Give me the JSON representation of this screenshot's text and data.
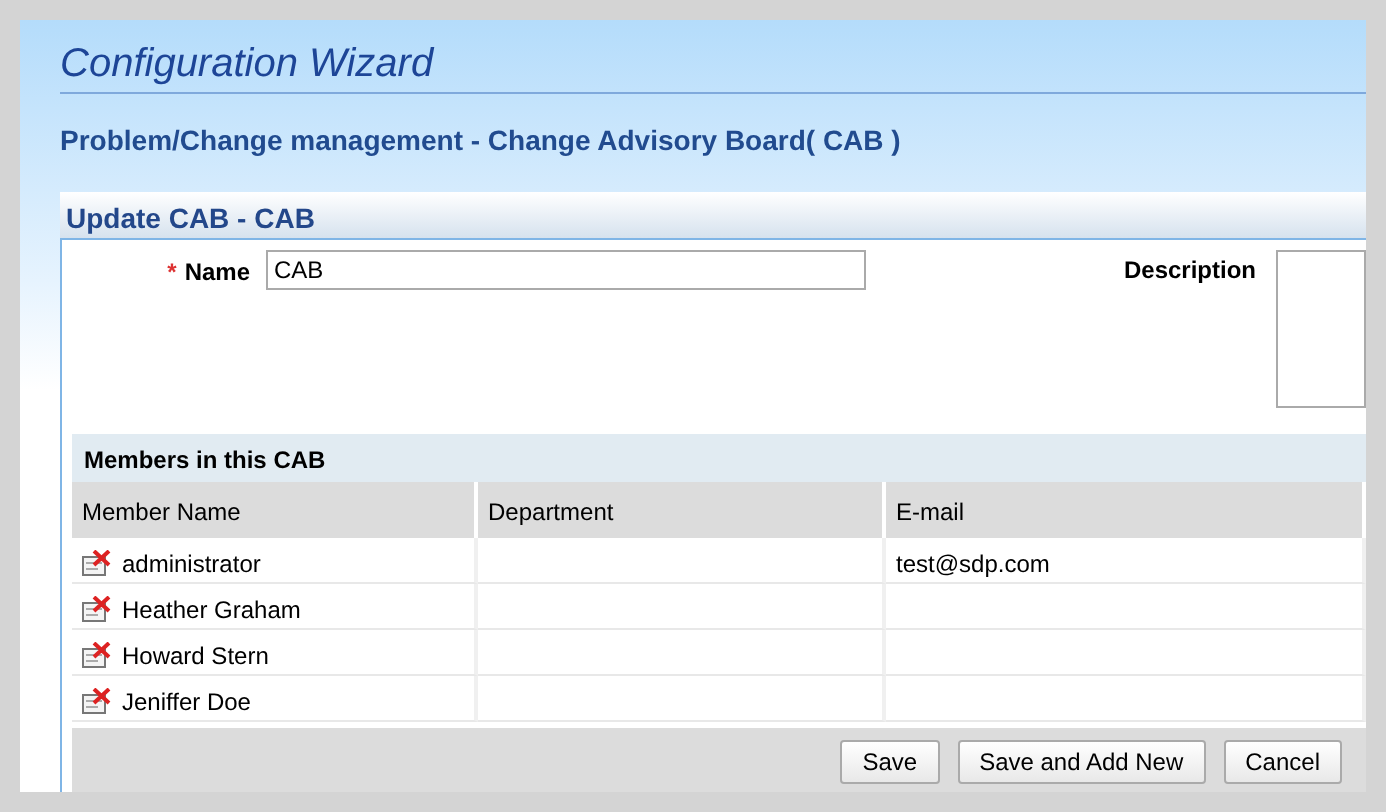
{
  "title": "Configuration Wizard",
  "subtitle": "Problem/Change management - Change Advisory Board( CAB )",
  "form": {
    "header": "Update CAB - CAB",
    "name_label": "Name",
    "required_mark": "*",
    "name_value": "CAB",
    "description_label": "Description"
  },
  "members": {
    "header": "Members in this CAB",
    "columns": [
      "Member Name",
      "Department",
      "E-mail"
    ],
    "rows": [
      {
        "member_name": "administrator",
        "email": "test@sdp.com"
      },
      {
        "member_name": "Heather Graham"
      },
      {
        "member_name": "Howard Stern"
      },
      {
        "member_name": "Jeniffer Doe"
      }
    ]
  },
  "buttons": [
    "Save",
    "Save and Add New",
    "Cancel"
  ]
}
